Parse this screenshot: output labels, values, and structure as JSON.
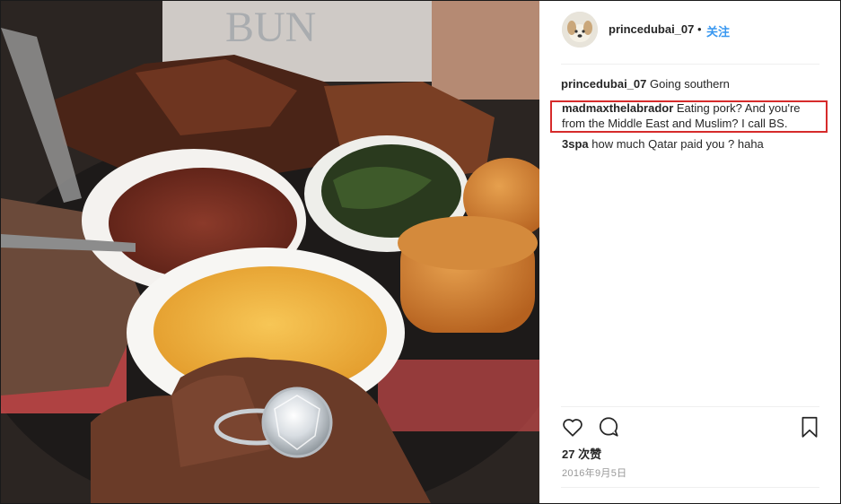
{
  "post": {
    "author": "princedubai_07",
    "follow_label": "关注",
    "separator": "•",
    "caption": "Going southern",
    "likes": "27 次赞",
    "date": "2016年9月5日",
    "comments": [
      {
        "user": "madmaxthelabrador",
        "text": "Eating pork? And you're from the Middle East and Muslim? I call BS."
      },
      {
        "user": "3spa",
        "text": "how much Qatar paid you ? haha"
      }
    ]
  },
  "icons": {
    "like": "heart-icon",
    "comment": "comment-bubble-icon",
    "save": "bookmark-icon"
  },
  "colors": {
    "accent": "#3897f0",
    "highlight": "#d62b2b",
    "text": "#262626"
  }
}
